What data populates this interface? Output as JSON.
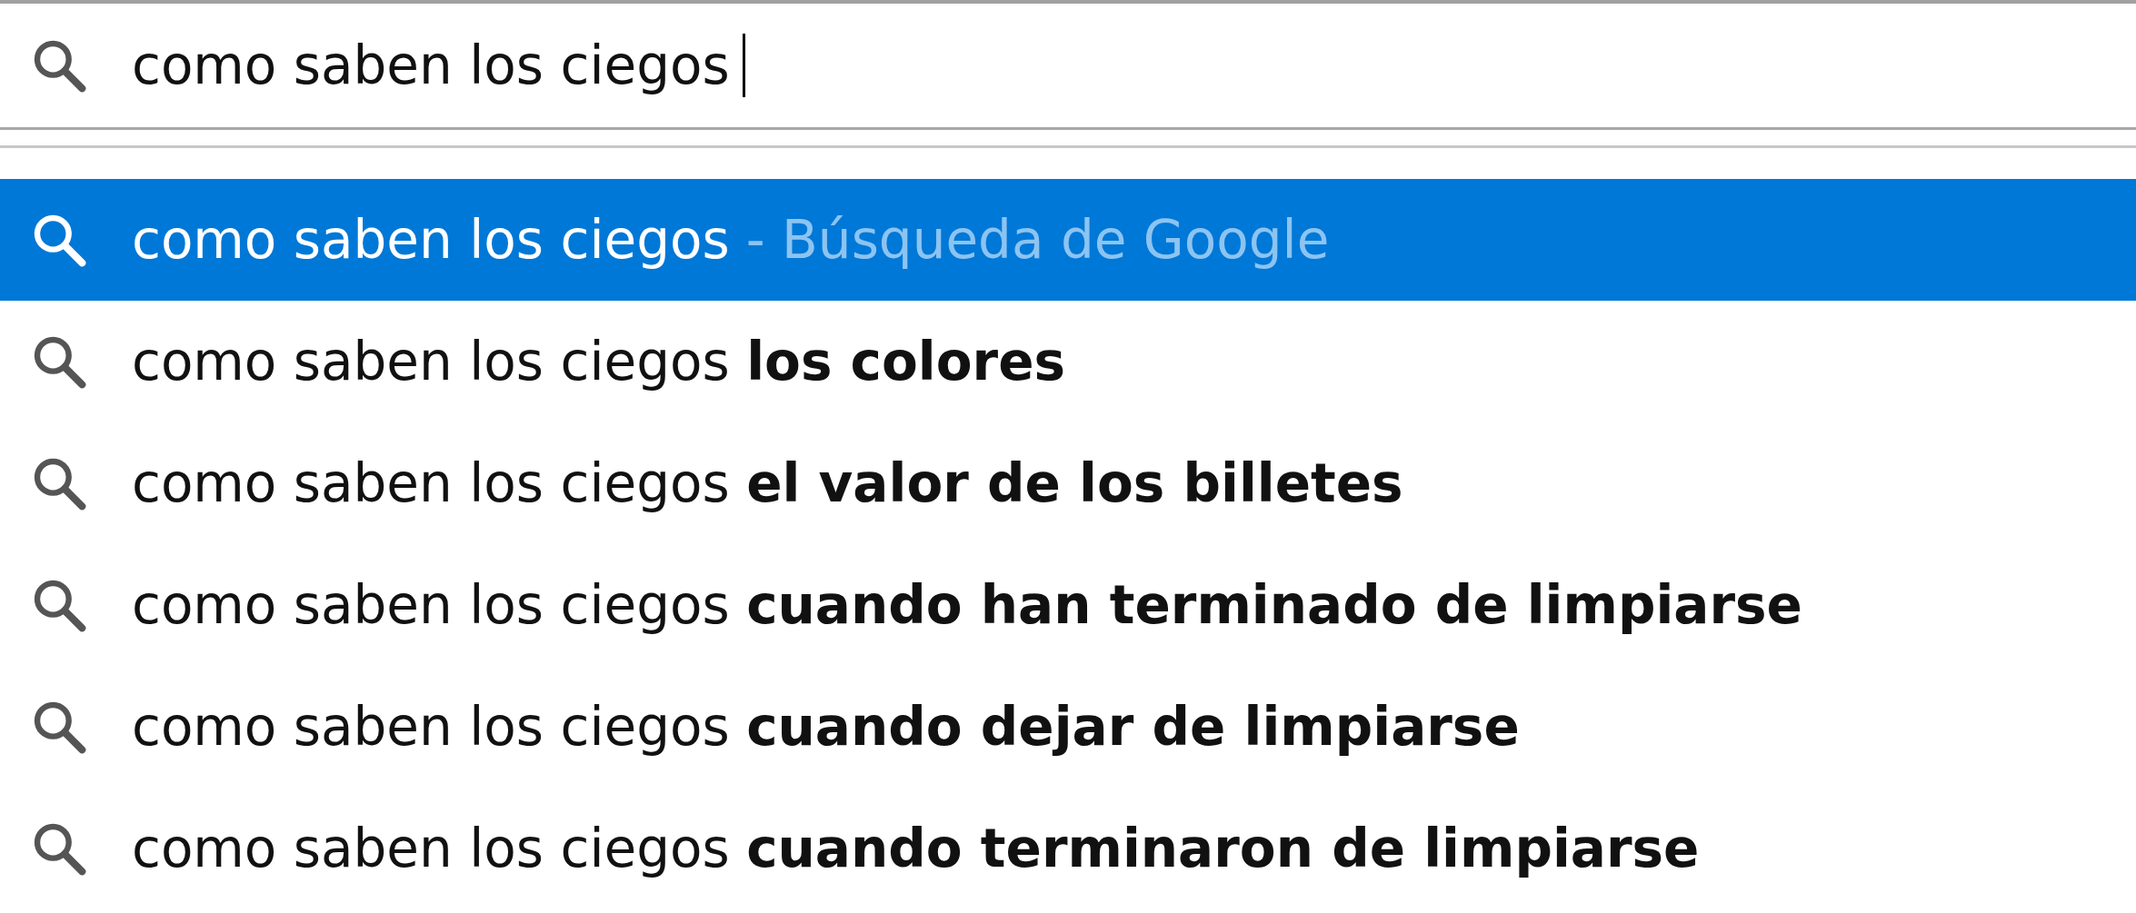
{
  "search": {
    "value": "como saben los ciegos",
    "caret": true
  },
  "suggestions": [
    {
      "text": "como saben los ciegos",
      "hint": "- Búsqueda de Google",
      "selected": true
    },
    {
      "text": "como saben los ciegos **los colores**",
      "selected": false
    },
    {
      "text": "como saben los ciegos **el valor de los billetes**",
      "selected": false
    },
    {
      "text": "como saben los ciegos **cuando han terminado de limpiarse**",
      "selected": false
    },
    {
      "text": "como saben los ciegos **cuando dejar de limpiarse**",
      "selected": false
    },
    {
      "text": "como saben los ciegos **cuando terminaron de limpiarse**",
      "selected": false
    }
  ]
}
